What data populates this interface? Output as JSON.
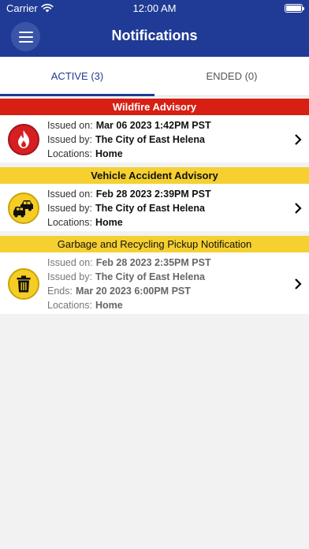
{
  "status": {
    "carrier": "Carrier",
    "time": "12:00 AM"
  },
  "header": {
    "title": "Notifications",
    "menu_icon": "hamburger-menu-icon"
  },
  "tabs": [
    {
      "label": "ACTIVE (3)",
      "selected": true
    },
    {
      "label": "ENDED (0)",
      "selected": false
    }
  ],
  "notifications": [
    {
      "title": "Wildfire Advisory",
      "banner_color": "#d71f14",
      "icon": "fire-icon",
      "issued_on_label": "Issued on:",
      "issued_on": "Mar 06 2023 1:42PM PST",
      "issued_by_label": "Issued by:",
      "issued_by": "The City of East Helena",
      "locations_label": "Locations:",
      "locations": "Home"
    },
    {
      "title": "Vehicle Accident Advisory",
      "banner_color": "#f5d030",
      "icon": "car-accident-icon",
      "issued_on_label": "Issued on:",
      "issued_on": "Feb 28 2023 2:39PM PST",
      "issued_by_label": "Issued by:",
      "issued_by": "The City of East Helena",
      "locations_label": "Locations:",
      "locations": "Home"
    },
    {
      "title": "Garbage and Recycling Pickup Notification",
      "banner_color": "#f5d030",
      "icon": "trash-can-icon",
      "issued_on_label": "Issued on:",
      "issued_on": "Feb 28 2023 2:35PM PST",
      "issued_by_label": "Issued by:",
      "issued_by": "The City of East Helena",
      "ends_label": "Ends:",
      "ends": "Mar 20 2023 6:00PM PST",
      "locations_label": "Locations:",
      "locations": "Home"
    }
  ]
}
